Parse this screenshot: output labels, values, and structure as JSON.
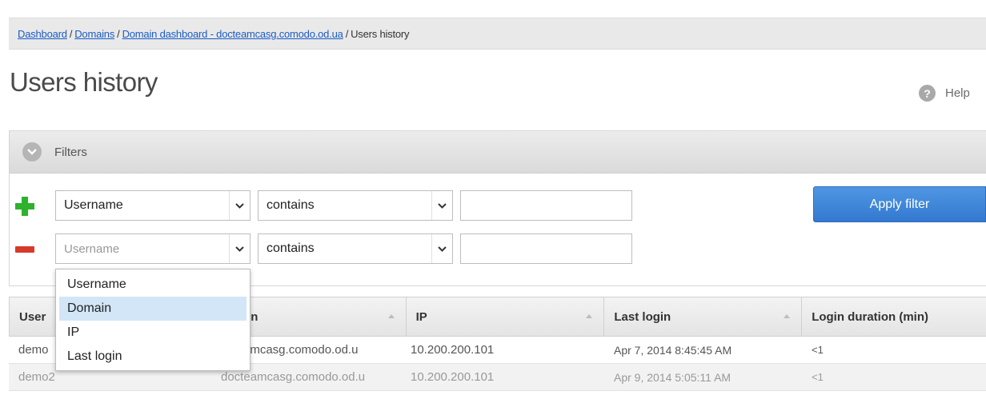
{
  "breadcrumb": {
    "items": [
      "Dashboard",
      "Domains",
      "Domain dashboard - docteamcasg.comodo.od.ua"
    ],
    "current": "Users history",
    "separator": "/"
  },
  "page": {
    "title": "Users history",
    "help_label": "Help",
    "help_icon": "help-circle-icon"
  },
  "filters": {
    "header_label": "Filters",
    "rows": [
      {
        "field": "Username",
        "operator": "contains",
        "value": ""
      },
      {
        "field": "Username",
        "operator": "contains",
        "value": ""
      }
    ],
    "apply_label": "Apply filter",
    "dropdown_options": [
      "Username",
      "Domain",
      "IP",
      "Last login"
    ],
    "dropdown_highlighted": "Domain"
  },
  "table": {
    "columns": [
      "User",
      "Domain",
      "IP",
      "Last login",
      "Login duration (min)"
    ],
    "visible_column_headers": [
      "User",
      "ain",
      "IP",
      "Last login",
      "Login duration (min)"
    ],
    "rows": [
      [
        "demo",
        "amcasg.comodo.od.u",
        "10.200.200.101",
        "Apr 7, 2014 8:45:45 AM",
        "<1"
      ],
      [
        "demo2",
        "docteamcasg.comodo.od.u",
        "10.200.200.101",
        "Apr 9, 2014 5:05:11 AM",
        "<1"
      ]
    ]
  },
  "colors": {
    "link": "#1a5cc8",
    "apply_button": "#3a82d6",
    "plus": "#2db22d",
    "minus": "#d63a2a",
    "dropdown_highlight": "#d2e6f7"
  }
}
